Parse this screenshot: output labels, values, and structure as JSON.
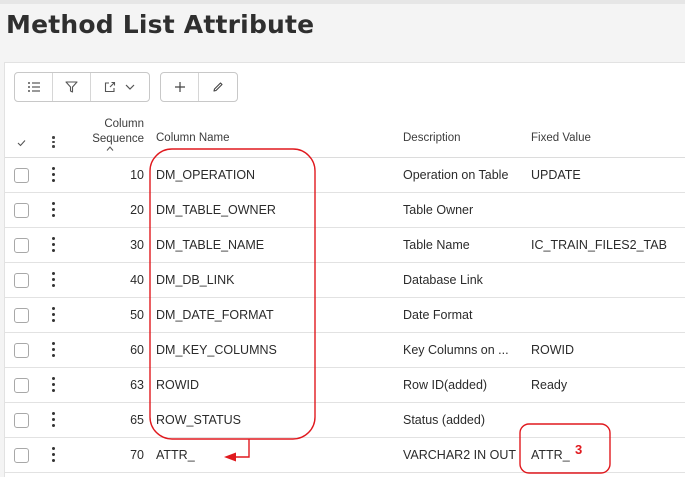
{
  "page": {
    "title": "Method List Attribute"
  },
  "toolbar": {
    "buttons": [
      {
        "icon": "list-view-icon"
      },
      {
        "icon": "filter-icon"
      },
      {
        "icon": "export-icon"
      },
      {
        "icon": "add-icon"
      },
      {
        "icon": "edit-icon"
      }
    ]
  },
  "table": {
    "headers": {
      "seq_line1": "Column",
      "seq_line2": "Sequence",
      "column_name": "Column Name",
      "description": "Description",
      "fixed_value": "Fixed Value"
    },
    "rows": [
      {
        "seq": "10",
        "name": "DM_OPERATION",
        "desc": "Operation on Table",
        "fixed": "UPDATE"
      },
      {
        "seq": "20",
        "name": "DM_TABLE_OWNER",
        "desc": "Table Owner",
        "fixed": ""
      },
      {
        "seq": "30",
        "name": "DM_TABLE_NAME",
        "desc": "Table Name",
        "fixed": "IC_TRAIN_FILES2_TAB"
      },
      {
        "seq": "40",
        "name": "DM_DB_LINK",
        "desc": "Database Link",
        "fixed": ""
      },
      {
        "seq": "50",
        "name": "DM_DATE_FORMAT",
        "desc": "Date Format",
        "fixed": ""
      },
      {
        "seq": "60",
        "name": "DM_KEY_COLUMNS",
        "desc": "Key Columns on ...",
        "fixed": "ROWID"
      },
      {
        "seq": "63",
        "name": "ROWID",
        "desc": "Row ID(added)",
        "fixed": "Ready"
      },
      {
        "seq": "65",
        "name": "ROW_STATUS",
        "desc": "Status (added)",
        "fixed": ""
      },
      {
        "seq": "70",
        "name": "ATTR_",
        "desc": "VARCHAR2 IN OUT",
        "fixed": "ATTR_"
      }
    ]
  },
  "annotation": {
    "label": "3",
    "color": "#e0191e"
  }
}
